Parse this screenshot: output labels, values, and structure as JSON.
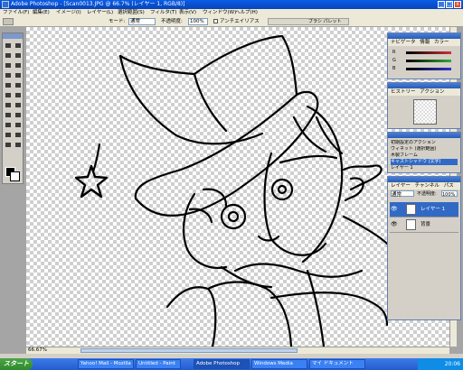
{
  "window": {
    "title": "Adobe Photoshop - [Scan0013.JPG @ 66.7% (レイヤー 1, RGB/8)]"
  },
  "menubar": {
    "items": [
      "ファイル(F)",
      "編集(E)",
      "イメージ(I)",
      "レイヤー(L)",
      "選択範囲(S)",
      "フィルタ(T)",
      "表示(V)",
      "ウィンドウ(W)",
      "ヘルプ(H)"
    ]
  },
  "options": {
    "mode_label": "モード:",
    "mode_value": "通常",
    "opacity_label": "不透明度:",
    "opacity_value": "100%",
    "antialias_label": "アンチエイリアス",
    "palette_label": "ブラシ パレット"
  },
  "statusbar": {
    "zoom": "66.67%"
  },
  "panels": {
    "navigator": {
      "tabs": [
        "ナビゲータ",
        "情報",
        "カラー"
      ],
      "channel_labels": [
        "R",
        "G",
        "B"
      ]
    },
    "history": {
      "tabs": [
        "ヒストリー",
        "アクション"
      ]
    },
    "actions": {
      "rows": [
        "初期設定のアクション",
        "ヴィネット (選択範囲)",
        "木製フレーム",
        "キャストシャドウ (文字)",
        "レイヤー 1"
      ]
    },
    "layers": {
      "tabs": [
        "レイヤー",
        "チャンネル",
        "パス"
      ],
      "blend": "通常",
      "opacity_label": "不透明度:",
      "opacity": "100%",
      "rows": [
        {
          "name": "レイヤー 1",
          "selected": true
        },
        {
          "name": "背景",
          "selected": false
        }
      ]
    }
  },
  "taskbar": {
    "start_label": "スタート",
    "tasks": [
      "Yahoo! Mail - Mozilla",
      "Untitled - Paint",
      "Adobe Photoshop",
      "Windows Media",
      "マイ ドキュメント"
    ],
    "clock": "20:06"
  }
}
